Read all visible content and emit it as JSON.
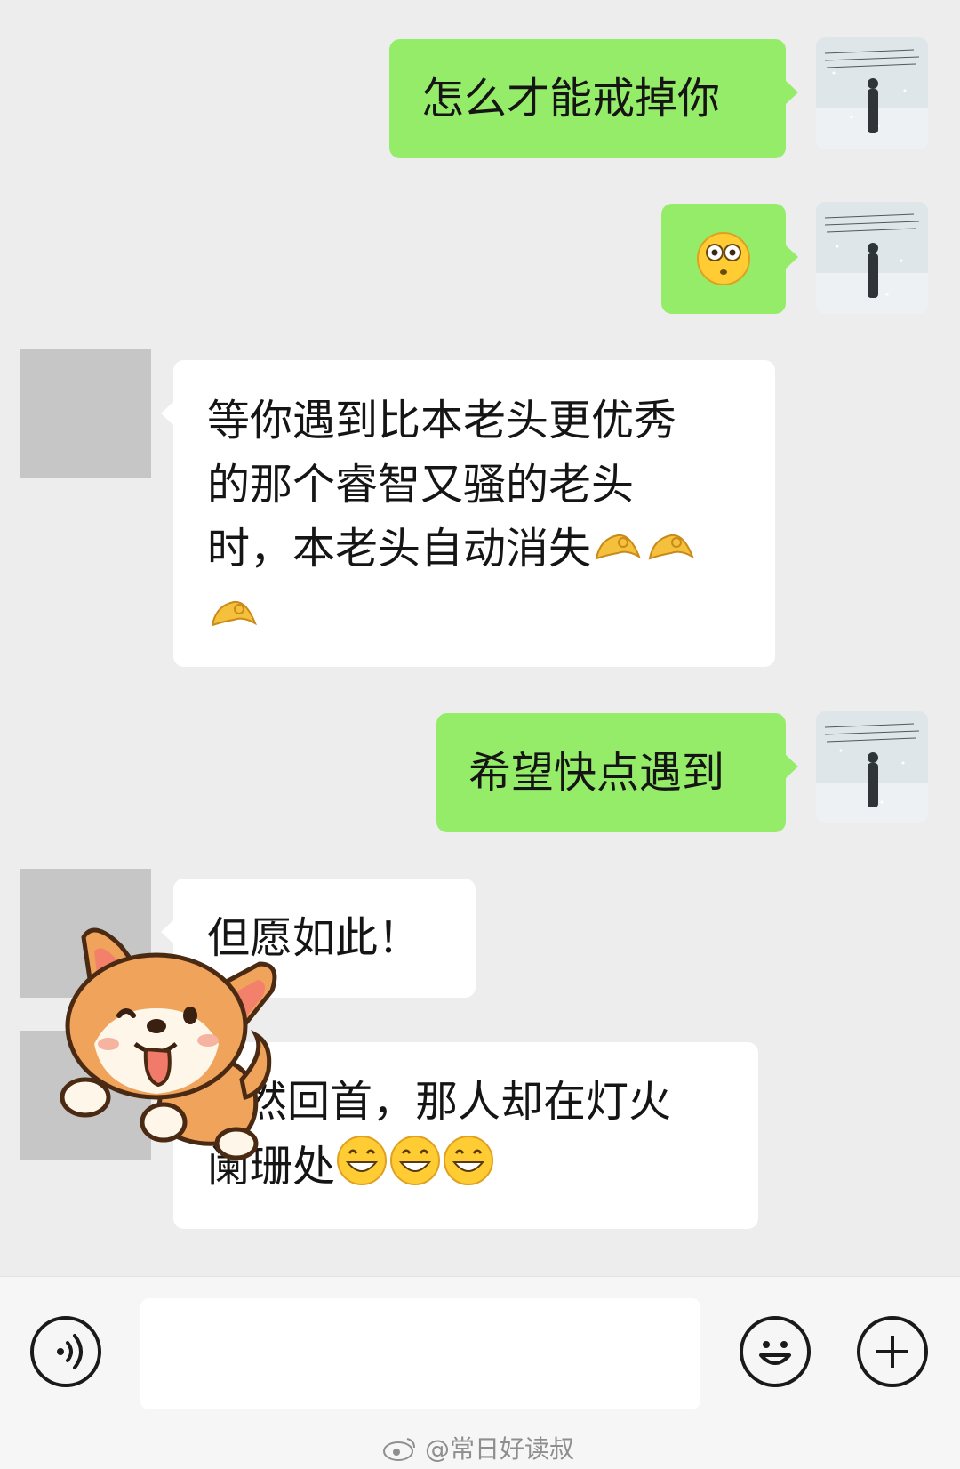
{
  "conversation": {
    "messages": [
      {
        "side": "mine",
        "text": "怎么才能戒掉你"
      },
      {
        "side": "mine",
        "emoji": "flushed-face"
      },
      {
        "side": "theirs",
        "lines": [
          "等你遇到比本老头更优秀",
          "的那个睿智又骚的老头",
          "时，本老头自动消失"
        ],
        "trailing_emoji": "ok-hand x3"
      },
      {
        "side": "mine",
        "text": "希望快点遇到"
      },
      {
        "side": "theirs",
        "text": "但愿如此！"
      },
      {
        "side": "theirs",
        "lines": [
          "蓦然回首，那人却在灯火",
          "阑珊处"
        ],
        "trailing_emoji": "grinning-face x3"
      }
    ],
    "m1": "怎么才能戒掉你",
    "m3_l1": "等你遇到比本老头更优秀",
    "m3_l2": "的那个睿智又骚的老头",
    "m3_l3": "时，本老头自动消失",
    "m4": "希望快点遇到",
    "m5": "但愿如此！",
    "m6_l1": "然回首，那人却在灯火",
    "m6_l2": "阑珊处"
  },
  "input_bar": {
    "voice_icon": "voice-icon",
    "emoji_icon": "emoji-icon",
    "plus_icon": "plus-icon",
    "input_value": ""
  },
  "watermark": {
    "text": "@常日好读叔",
    "icon": "weibo-icon"
  },
  "colors": {
    "background": "#ededed",
    "mine_bubble": "#95ec69",
    "theirs_bubble": "#ffffff",
    "avatar_placeholder": "#c6c6c6"
  }
}
